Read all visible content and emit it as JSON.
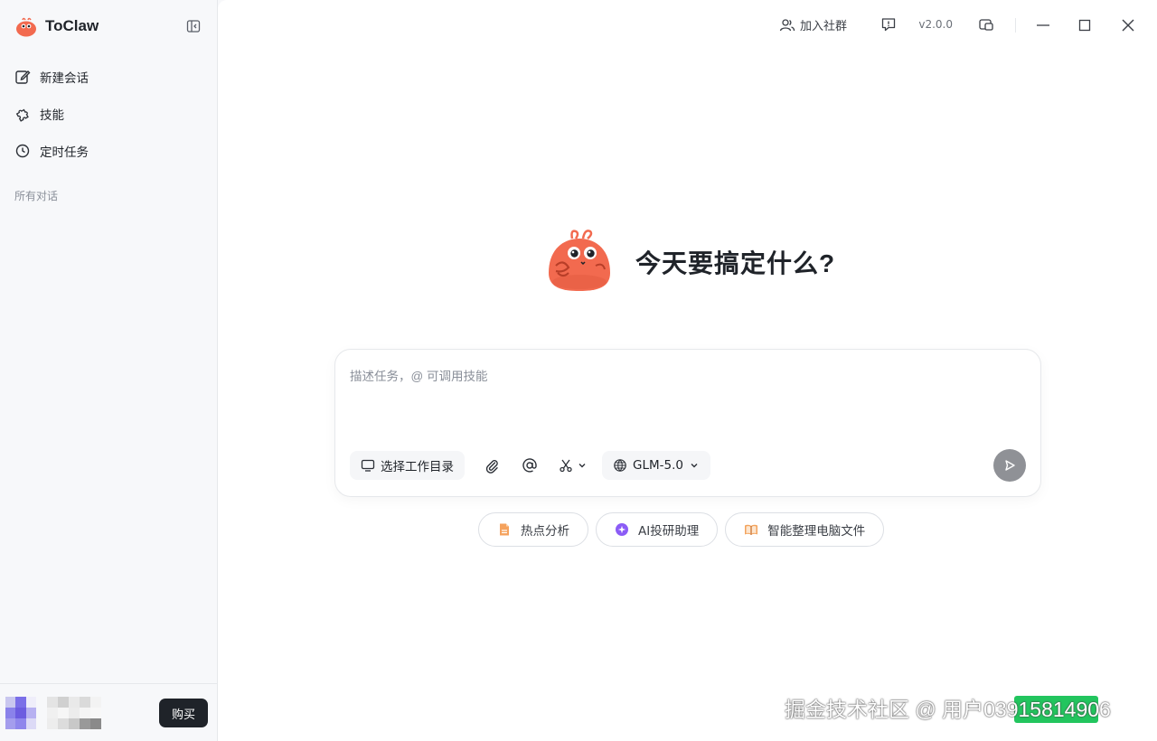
{
  "app": {
    "name": "ToClaw",
    "version": "v2.0.0"
  },
  "sidebar": {
    "items": [
      {
        "label": "新建会话",
        "icon": "edit-icon"
      },
      {
        "label": "技能",
        "icon": "puzzle-icon"
      },
      {
        "label": "定时任务",
        "icon": "clock-icon"
      }
    ],
    "section_label": "所有对话",
    "buy_label": "购买"
  },
  "titlebar": {
    "join_label": "加入社群"
  },
  "main": {
    "heading": "今天要搞定什么?",
    "composer": {
      "placeholder": "描述任务，@ 可调用技能",
      "workdir_label": "选择工作目录",
      "model_label": "GLM-5.0"
    },
    "suggestions": [
      {
        "label": "热点分析",
        "icon": "document-icon"
      },
      {
        "label": "AI投研助理",
        "icon": "sparkle-icon"
      },
      {
        "label": "智能整理电脑文件",
        "icon": "book-icon"
      }
    ]
  },
  "watermark": "掘金技术社区 @ 用户03915814906",
  "colors": {
    "accent": "#1f2329",
    "mascot": "#f26a4f",
    "send_disabled": "#8f9196",
    "watermark_green": "#22c55e"
  }
}
